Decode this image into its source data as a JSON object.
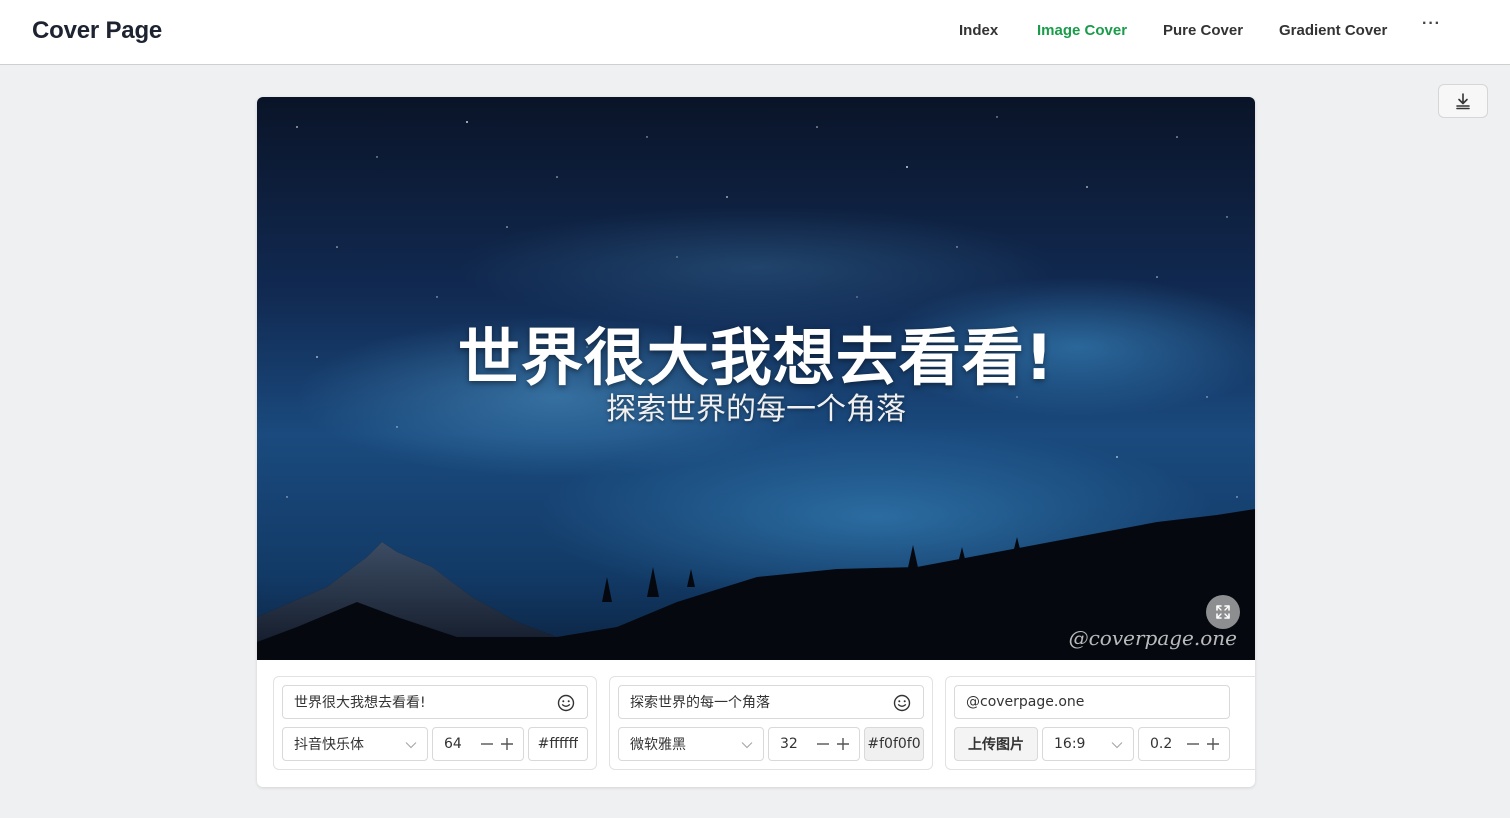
{
  "app": {
    "title": "Cover Page"
  },
  "nav": {
    "items": [
      {
        "label": "Index",
        "active": false
      },
      {
        "label": "Image Cover",
        "active": true
      },
      {
        "label": "Pure Cover",
        "active": false
      },
      {
        "label": "Gradient Cover",
        "active": false
      }
    ],
    "more_label": "···"
  },
  "cover": {
    "title": "世界很大我想去看看!",
    "subtitle": "探索世界的每一个角落",
    "watermark": "@coverpage.one",
    "title_color": "#ffffff",
    "subtitle_color": "#f0f0f0"
  },
  "controls": {
    "title": {
      "text": "世界很大我想去看看!",
      "font": "抖音快乐体",
      "size": "64",
      "color": "#ffffff"
    },
    "subtitle": {
      "text": "探索世界的每一个角落",
      "font": "微软雅黑",
      "size": "32",
      "color": "#f0f0f0"
    },
    "watermark": {
      "text": "@coverpage.one",
      "upload_label": "上传图片",
      "ratio": "16:9",
      "opacity": "0.2"
    }
  },
  "icons": {
    "download": "download-icon",
    "fullscreen": "fullscreen-icon",
    "emoji": "emoji-icon",
    "chevron": "chevron-down-icon",
    "minus": "minus-icon",
    "plus": "plus-icon"
  },
  "theme": {
    "accent": "#1a9c4a",
    "sky_dark": "#0b1730",
    "sky_mid": "#14315c"
  }
}
